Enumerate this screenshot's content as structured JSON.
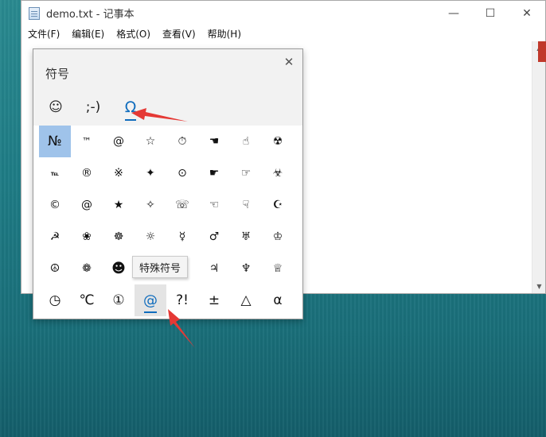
{
  "notepad": {
    "title": "demo.txt - 记事本",
    "menu": [
      "文件(F)",
      "编辑(E)",
      "格式(O)",
      "查看(V)",
      "帮助(H)"
    ],
    "controls": {
      "minimize": "—",
      "maximize": "☐",
      "close": "✕"
    }
  },
  "panel": {
    "title": "符号",
    "close": "✕",
    "tabs": [
      {
        "label": "☺",
        "icon": "smiley-icon"
      },
      {
        "label": ";-)",
        "icon": "kaomoji-icon"
      },
      {
        "label": "Ω",
        "icon": "omega-icon"
      }
    ],
    "active_tab": 2,
    "symbols": [
      [
        "№",
        "™",
        "@",
        "☆",
        "⏱",
        "☚",
        "☝",
        "☢"
      ],
      [
        "℡",
        "®",
        "※",
        "✦",
        "⊙",
        "☛",
        "☞",
        "☣"
      ],
      [
        "©",
        "@",
        "★",
        "✧",
        "☏",
        "☜",
        "☟",
        "☪"
      ],
      [
        "☭",
        "❀",
        "☸",
        "☼",
        "☿",
        "♂",
        "♅",
        "♔"
      ],
      [
        "☮",
        "❁",
        "☻",
        "",
        "",
        "♃",
        "♆",
        "♕"
      ],
      [
        "◷",
        "℃",
        "①",
        "@",
        "?!",
        "±",
        "△",
        "α"
      ]
    ],
    "selected_symbol": "№",
    "focused_symbol": "@",
    "tooltip": "特殊符号"
  },
  "colors": {
    "accent": "#0f6cbd",
    "selected": "#9fc3ea",
    "arrow": "#e53935"
  }
}
